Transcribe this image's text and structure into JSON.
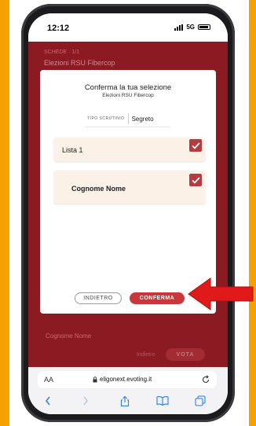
{
  "status_bar": {
    "time": "12:12",
    "network": "5G"
  },
  "background_page": {
    "breadcrumb": "SCHEDE · 1/1",
    "title": "Elezioni RSU Fibercop",
    "item_name": "Cognome Nome",
    "vota_label": "VOTA"
  },
  "modal": {
    "title": "Conferma la tua selezione",
    "subtitle": "Elezioni RSU Fibercop",
    "scrutinio_label": "TIPO SCRUTINIO",
    "scrutinio_value": "Segreto",
    "selections": [
      {
        "label": "Lista 1",
        "checked": true
      },
      {
        "label": "Cognome Nome",
        "checked": true
      }
    ],
    "back_label": "INDIETRO",
    "confirm_label": "CONFERMA"
  },
  "browser": {
    "aa_label": "AA",
    "url": "eligonext.evoting.it"
  },
  "colors": {
    "accent_red": "#c9373a",
    "frame_orange": "#f5a100",
    "page_maroon": "#8c1a22",
    "card_bg": "#fbf1e6",
    "annotation_arrow": "#e01a1a"
  },
  "icons": [
    "signal-icon",
    "battery-icon",
    "check-icon",
    "lock-icon",
    "reload-icon",
    "back-icon",
    "forward-icon",
    "share-icon",
    "bookmarks-icon",
    "tabs-icon",
    "red-arrow-annotation"
  ]
}
